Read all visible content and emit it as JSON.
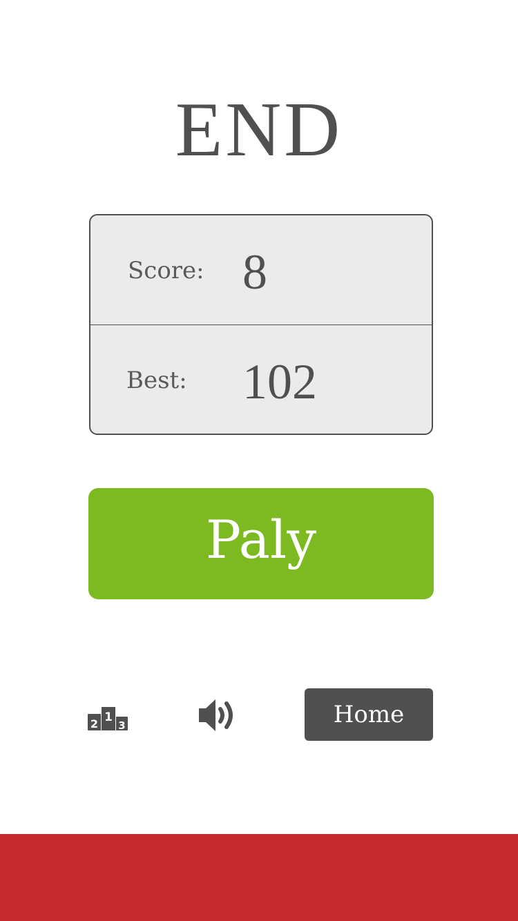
{
  "screen": {
    "title": "END"
  },
  "scores": {
    "score_label": "Score:",
    "score_value": "8",
    "best_label": "Best:",
    "best_value": "102"
  },
  "buttons": {
    "play_label": "Paly",
    "home_label": "Home",
    "leaderboard_icon": "leaderboard-podium-icon",
    "sound_icon": "speaker-volume-icon"
  },
  "colors": {
    "play_button": "#7dba21",
    "home_button": "#505050",
    "footer_bar": "#c62a2e",
    "score_panel": "#ebebeb",
    "text": "#505050"
  }
}
